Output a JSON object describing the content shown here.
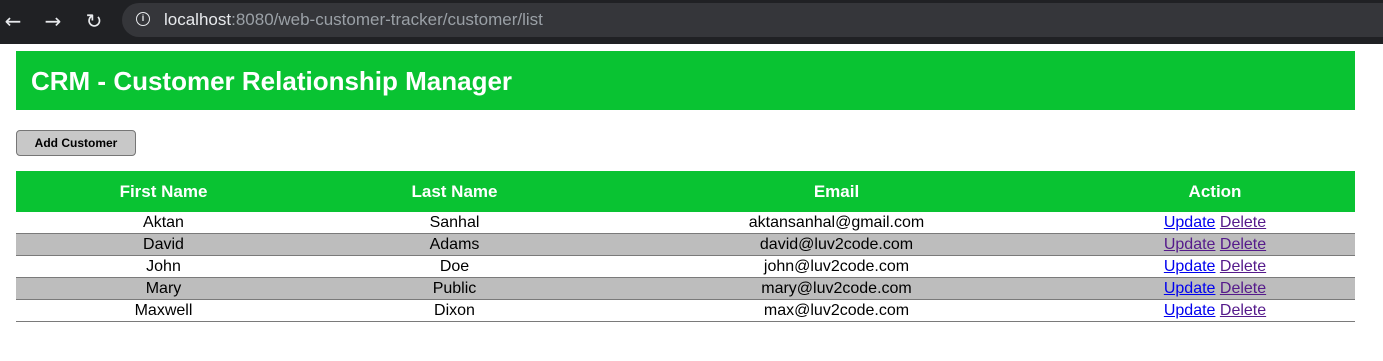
{
  "browser": {
    "url_host": "localhost",
    "url_rest": ":8080/web-customer-tracker/customer/list",
    "icons": {
      "back": "back-arrow-icon",
      "forward": "forward-arrow-icon",
      "reload": "reload-icon",
      "site_info": "info-icon"
    }
  },
  "header": {
    "title": "CRM - Customer Relationship Manager"
  },
  "actions": {
    "add_customer_label": "Add Customer"
  },
  "table": {
    "columns": [
      "First Name",
      "Last Name",
      "Email",
      "Action"
    ],
    "rows": [
      {
        "first_name": "Aktan",
        "last_name": "Sanhal",
        "email": "aktansanhal@gmail.com",
        "update_label": "Update",
        "delete_label": "Delete"
      },
      {
        "first_name": "David",
        "last_name": "Adams",
        "email": "david@luv2code.com",
        "update_label": "Update",
        "delete_label": "Delete"
      },
      {
        "first_name": "John",
        "last_name": "Doe",
        "email": "john@luv2code.com",
        "update_label": "Update",
        "delete_label": "Delete"
      },
      {
        "first_name": "Mary",
        "last_name": "Public",
        "email": "mary@luv2code.com",
        "update_label": "Update",
        "delete_label": "Delete"
      },
      {
        "first_name": "Maxwell",
        "last_name": "Dixon",
        "email": "max@luv2code.com",
        "update_label": "Update",
        "delete_label": "Delete"
      }
    ]
  },
  "colors": {
    "brand_green": "#09c332",
    "alt_row": "#bdbdbd",
    "link": "#0000ee",
    "visited_link": "#551a8b"
  }
}
